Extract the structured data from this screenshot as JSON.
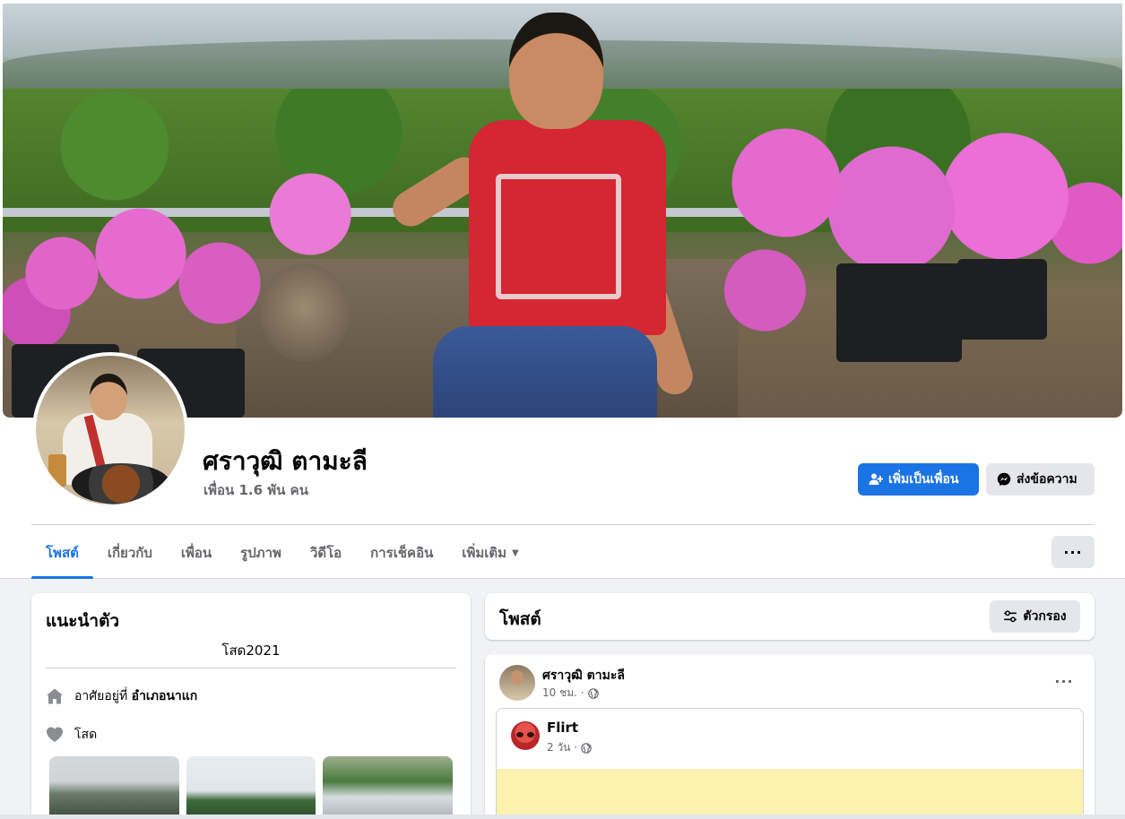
{
  "profile": {
    "name": "ศราวุฒิ ตามะลี",
    "friends": "เพื่อน 1.6 พัน คน"
  },
  "actions": {
    "add_friend": "เพิ่มเป็นเพื่อน",
    "message": "ส่งข้อความ"
  },
  "tabs": [
    {
      "label": "โพสต์",
      "active": true
    },
    {
      "label": "เกี่ยวกับ"
    },
    {
      "label": "เพื่อน"
    },
    {
      "label": "รูปภาพ"
    },
    {
      "label": "วิดีโอ"
    },
    {
      "label": "การเช็คอิน"
    },
    {
      "label": "เพิ่มเติม"
    }
  ],
  "more_menu": "···",
  "intro": {
    "title": "แนะนำตัว",
    "bio": "โสด2021",
    "lives_in_prefix": "อาศัยอยู่ที่",
    "lives_in_place": "อำเภอนาแก",
    "relationship": "โสด"
  },
  "posts": {
    "title": "โพสต์",
    "filter_label": "ตัวกรอง"
  },
  "post": {
    "author": "ศราวุฒิ ตามะลี",
    "time": "10 ชม. ·",
    "more": "···",
    "shared": {
      "name": "Flirt",
      "time": "2 วัน ·"
    }
  },
  "colors": {
    "accent": "#1b74e4",
    "secondary_button": "#e4e6eb",
    "page_bg": "#f0f2f5",
    "shared_post_bg": "#fdf1b0"
  },
  "icons": {
    "add_friend": "person-plus-icon",
    "message": "messenger-icon",
    "filter": "filter-sliders-icon",
    "home": "home-icon",
    "heart": "heart-icon",
    "globe": "globe-icon",
    "caret": "caret-down-icon"
  }
}
